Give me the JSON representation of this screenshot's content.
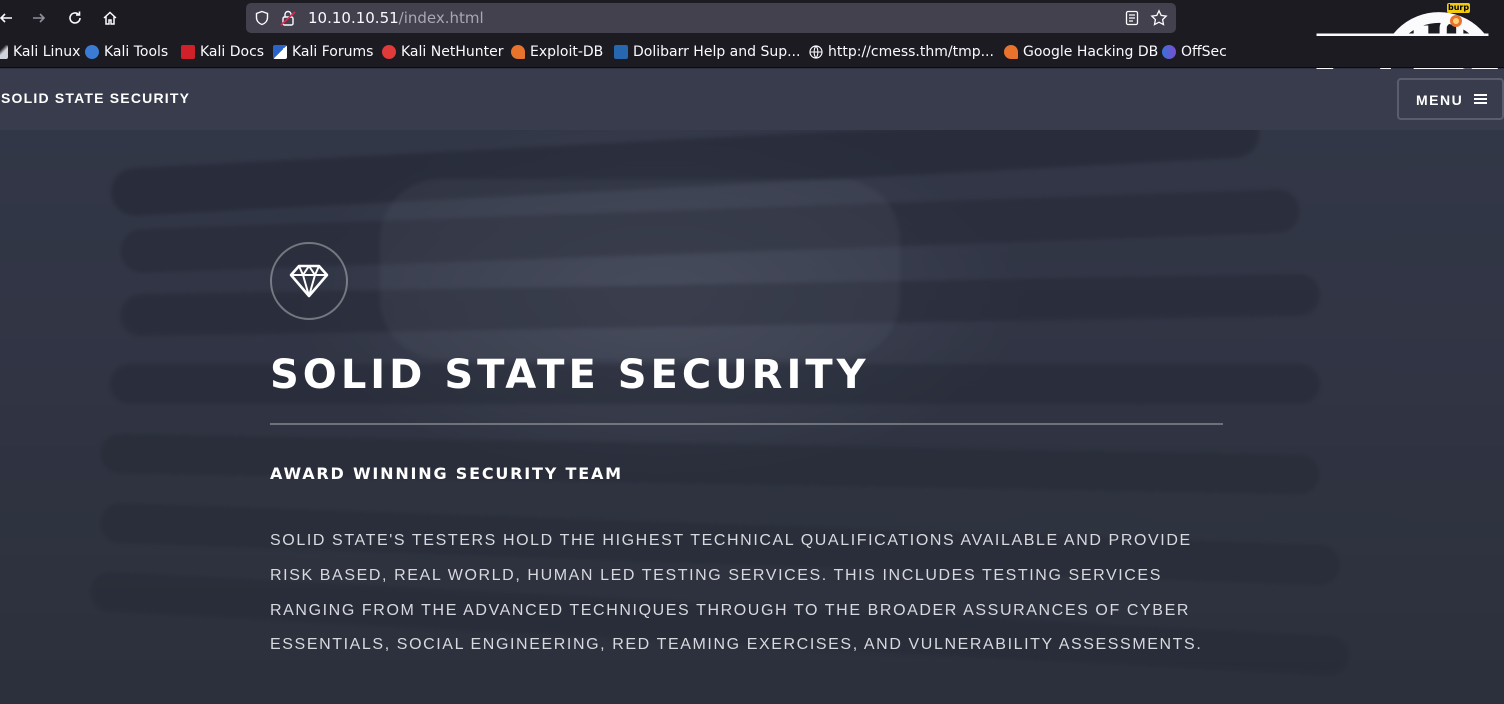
{
  "browser": {
    "url_host": "10.10.10.51",
    "url_path": "/index.html",
    "extension_badge": "burp",
    "bookmarks": [
      {
        "label": "Kali Linux"
      },
      {
        "label": "Kali Tools"
      },
      {
        "label": "Kali Docs"
      },
      {
        "label": "Kali Forums"
      },
      {
        "label": "Kali NetHunter"
      },
      {
        "label": "Exploit-DB"
      },
      {
        "label": "Dolibarr Help and Sup..."
      },
      {
        "label": "http://cmess.thm/tmp..."
      },
      {
        "label": "Google Hacking DB"
      },
      {
        "label": "OffSec"
      }
    ]
  },
  "site": {
    "logo": "SOLID STATE SECURITY",
    "menu_label": "MENU",
    "hero": {
      "icon": "diamond-icon",
      "title": "SOLID STATE SECURITY",
      "subtitle": "AWARD WINNING SECURITY TEAM",
      "body": "Solid State's testers hold the highest technical qualifications available and provide risk based, real world, human led testing services. This includes testing services ranging from the advanced techniques through to the broader assurances of Cyber Essentials, Social Engineering, Red Teaming exercises, and vulnerability assessments."
    }
  },
  "colors": {
    "chrome_bg": "#1c1b22",
    "urlbar_bg": "#42414d",
    "header_bg": "#393c4c",
    "page_bg": "#2e3140"
  }
}
